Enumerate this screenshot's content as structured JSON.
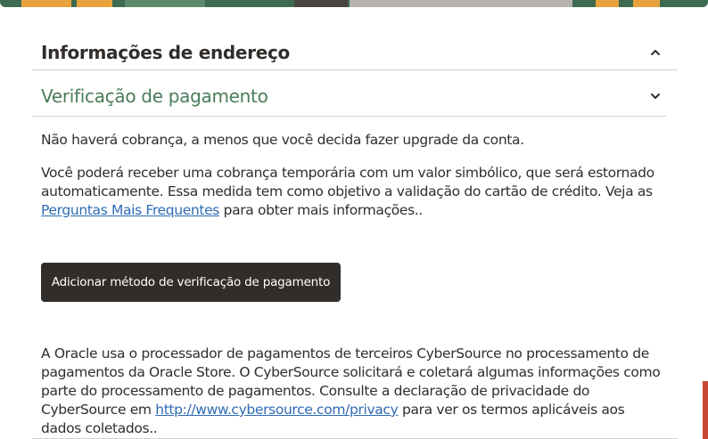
{
  "sections": [
    {
      "title": "Informações de endereço",
      "state": "collapse",
      "toggle_icon": "chevron-up-icon"
    },
    {
      "title": "Verificação de pagamento",
      "state": "expanded",
      "toggle_icon": "chevron-down-icon"
    }
  ],
  "payment": {
    "line1": "Não haverá cobrança, a menos que você decida fazer upgrade da conta.",
    "line2_before": "Você poderá receber uma cobrança temporária com um valor simbólico, que será estornado automaticamente. Essa medida tem como objetivo a validação do cartão de crédito. Veja as",
    "faq_link": "Perguntas Mais Frequentes",
    "line2_after": "para obter mais informações..",
    "button_label": "Adicionar método de verificação de pagamento",
    "processor_before": "A Oracle usa o processador de pagamentos de terceiros CyberSource no processamento de pagamentos da Oracle Store. O CyberSource solicitará e coletará algumas informações como parte do processamento de pagamentos. Consulte a declaração de privacidade do CyberSource em",
    "privacy_link": "http://www.cybersource.com/privacy",
    "processor_after": "para ver os termos aplicáveis aos dados coletados.."
  },
  "colors": {
    "section_title_active": "#4a7c59",
    "button_bg": "#312d2a",
    "link": "#2d6bb5",
    "accent_tab": "#c74634"
  }
}
